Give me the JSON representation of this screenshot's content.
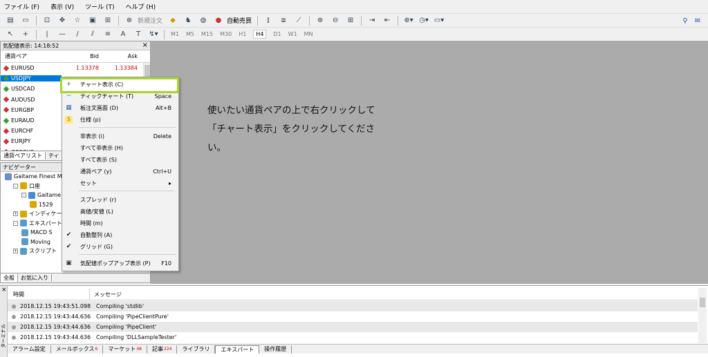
{
  "menu": [
    "ファイル (F)",
    "表示 (V)",
    "ツール (T)",
    "ヘルプ (H)"
  ],
  "toolbar1": {
    "new_order": "新規注文",
    "auto_trade": "自動売買"
  },
  "toolbar2": {
    "timeframes": [
      "M1",
      "M5",
      "M15",
      "M30",
      "H1",
      "H4",
      "D1",
      "W1",
      "MN"
    ],
    "selected": "H4"
  },
  "market_watch": {
    "title": "気配値表示: 14:18:52",
    "col_symbol": "通貨ペア",
    "col_bid": "Bid",
    "col_ask": "Ask",
    "rows": [
      {
        "symbol": "EURUSD",
        "bid": "1.13378",
        "ask": "1.13384",
        "dir": "down"
      },
      {
        "symbol": "USDJPY",
        "bid": "",
        "ask": "",
        "dir": "up",
        "selected": true
      },
      {
        "symbol": "USDCAD",
        "bid": "",
        "ask": "",
        "dir": "up"
      },
      {
        "symbol": "AUDUSD",
        "bid": "",
        "ask": "",
        "dir": "down"
      },
      {
        "symbol": "EURGBP",
        "bid": "",
        "ask": "",
        "dir": "down"
      },
      {
        "symbol": "EURAUD",
        "bid": "",
        "ask": "",
        "dir": "up"
      },
      {
        "symbol": "EURCHF",
        "bid": "",
        "ask": "",
        "dir": "down"
      },
      {
        "symbol": "EURJPY",
        "bid": "",
        "ask": "",
        "dir": "down"
      },
      {
        "symbol": "GBPCHF",
        "bid": "",
        "ask": "",
        "dir": "down"
      }
    ],
    "tabs": [
      "通貨ペアリスト",
      "ティ"
    ]
  },
  "navigator": {
    "title": "ナビゲーター",
    "items": [
      {
        "label": "Gaitame Finest M",
        "level": 0,
        "box": ""
      },
      {
        "label": "口座",
        "level": 1,
        "box": "-"
      },
      {
        "label": "Gaitame",
        "level": 2,
        "box": "-"
      },
      {
        "label": "1529",
        "level": 3,
        "box": ""
      },
      {
        "label": "インディケータ",
        "level": 1,
        "box": "+"
      },
      {
        "label": "エキスパートア",
        "level": 1,
        "box": "-"
      },
      {
        "label": "MACD S",
        "level": 2,
        "box": ""
      },
      {
        "label": "Moving",
        "level": 2,
        "box": ""
      },
      {
        "label": "スクリプト",
        "level": 1,
        "box": "+"
      }
    ],
    "tabs": [
      "全般",
      "お気に入り"
    ]
  },
  "context_menu": {
    "items": [
      {
        "label": "チャート表示 (C)",
        "key": "",
        "icon": "+",
        "highlight": true
      },
      {
        "label": "ティックチャート (T)",
        "key": "Space",
        "icon": "~"
      },
      {
        "label": "板注文画面 (D)",
        "key": "Alt+B",
        "icon": "▦"
      },
      {
        "label": "仕様 (p)",
        "key": "",
        "icon": "$"
      },
      {
        "label": "非表示 (i)",
        "key": "Delete",
        "icon": ""
      },
      {
        "label": "すべて非表示 (H)",
        "key": "",
        "icon": ""
      },
      {
        "label": "すべて表示 (S)",
        "key": "",
        "icon": ""
      },
      {
        "label": "通貨ペア (y)",
        "key": "Ctrl+U",
        "icon": ""
      },
      {
        "label": "セット",
        "key": "▸",
        "icon": ""
      },
      {
        "label": "スプレッド (r)",
        "key": "",
        "icon": ""
      },
      {
        "label": "高値/安値 (L)",
        "key": "",
        "icon": ""
      },
      {
        "label": "時間 (m)",
        "key": "",
        "icon": ""
      },
      {
        "label": "自動整列 (A)",
        "key": "",
        "icon": "✔"
      },
      {
        "label": "グリッド (G)",
        "key": "",
        "icon": "✔"
      },
      {
        "label": "気配値ポップアップ表示 (P)",
        "key": "F10",
        "icon": "▣"
      }
    ]
  },
  "instruction": {
    "line1": "使いたい通貨ペアの上で右クリックして",
    "line2": "「チャート表示」をクリックしてくださ",
    "line3": "い。"
  },
  "terminal": {
    "label": "ターミナル",
    "col_time": "時間",
    "col_message": "メッセージ",
    "rows": [
      {
        "time": "2018.12.15 19:43:51.098",
        "message": "Compiling 'stdlib'"
      },
      {
        "time": "2018.12.15 19:43:44.636",
        "message": "Compiling 'PipeClientPure'"
      },
      {
        "time": "2018.12.15 19:43:44.636",
        "message": "Compiling 'PipeClient'"
      },
      {
        "time": "2018.12.15 19:43:44.636",
        "message": "Compiling 'DLLSampleTester'"
      }
    ],
    "tabs": [
      {
        "label": "アラーム設定",
        "badge": ""
      },
      {
        "label": "メールボックス",
        "badge": "6"
      },
      {
        "label": "マーケット",
        "badge": "48"
      },
      {
        "label": "記事",
        "badge": "224"
      },
      {
        "label": "ライブラリ",
        "badge": ""
      },
      {
        "label": "エキスパート",
        "badge": "",
        "active": true
      },
      {
        "label": "操作履歴",
        "badge": ""
      }
    ]
  },
  "colors": {
    "accent_highlight": "#a6d62a",
    "selection": "#0078d7",
    "price_red": "#d00000",
    "chart_bg": "#ababab"
  }
}
